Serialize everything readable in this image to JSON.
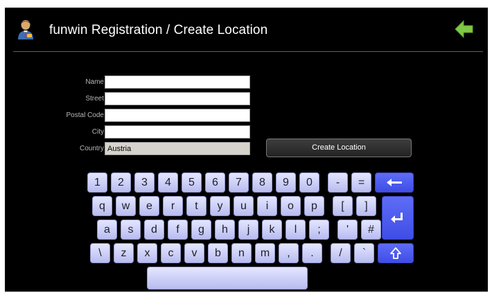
{
  "header": {
    "title": "funwin Registration / Create Location",
    "back_icon": "back-arrow-icon",
    "user_icon": "user-icon"
  },
  "form": {
    "fields": [
      {
        "key": "name",
        "label": "Name",
        "value": ""
      },
      {
        "key": "street",
        "label": "Street",
        "value": ""
      },
      {
        "key": "postal_code",
        "label": "Postal Code",
        "value": ""
      },
      {
        "key": "city",
        "label": "City",
        "value": ""
      },
      {
        "key": "country",
        "label": "Country",
        "value": "Austria"
      }
    ],
    "create_button": "Create Location"
  },
  "keyboard": {
    "rows": [
      [
        "1",
        "2",
        "3",
        "4",
        "5",
        "6",
        "7",
        "8",
        "9",
        "0",
        "-",
        "="
      ],
      [
        "q",
        "w",
        "e",
        "r",
        "t",
        "y",
        "u",
        "i",
        "o",
        "p",
        "[",
        "]"
      ],
      [
        "a",
        "s",
        "d",
        "f",
        "g",
        "h",
        "j",
        "k",
        "l",
        ";",
        "'",
        "#"
      ],
      [
        "\\",
        "z",
        "x",
        "c",
        "v",
        "b",
        "n",
        "m",
        ",",
        ".",
        "/",
        "`"
      ]
    ],
    "backspace_icon": "backspace-icon",
    "enter_icon": "enter-icon",
    "shift_icon": "shift-icon",
    "space_label": ""
  },
  "colors": {
    "background": "#000000",
    "key_fill": "#d2d5fb",
    "function_key_fill": "#4b57ee",
    "back_arrow": "#7ec845"
  }
}
